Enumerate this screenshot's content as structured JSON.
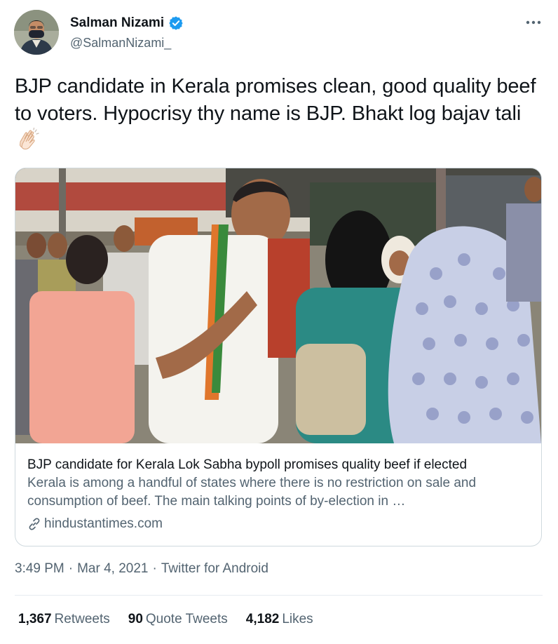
{
  "author": {
    "display_name": "Salman Nizami",
    "handle": "@SalmanNizami_",
    "verified": true
  },
  "tweet": {
    "text": "BJP candidate in Kerala promises clean, good quality beef to voters. Hypocrisy thy name is BJP. Bhakt log bajav tali",
    "emoji": "clapping-hands"
  },
  "link_card": {
    "title": "BJP candidate for Kerala Lok Sabha bypoll promises quality beef if elected",
    "description": "Kerala is among a handful of states where there is no restriction on sale and consumption of beef. The main talking points of by-election in …",
    "domain": "hindustantimes.com"
  },
  "meta": {
    "time": "3:49 PM",
    "date": "Mar 4, 2021",
    "source": "Twitter for Android",
    "separator": "·"
  },
  "stats": {
    "retweets_count": "1,367",
    "retweets_label": "Retweets",
    "quotes_count": "90",
    "quotes_label": "Quote Tweets",
    "likes_count": "4,182",
    "likes_label": "Likes"
  },
  "colors": {
    "verified_badge": "#1d9bf0",
    "secondary_text": "#536471",
    "border": "#cfd9de"
  }
}
